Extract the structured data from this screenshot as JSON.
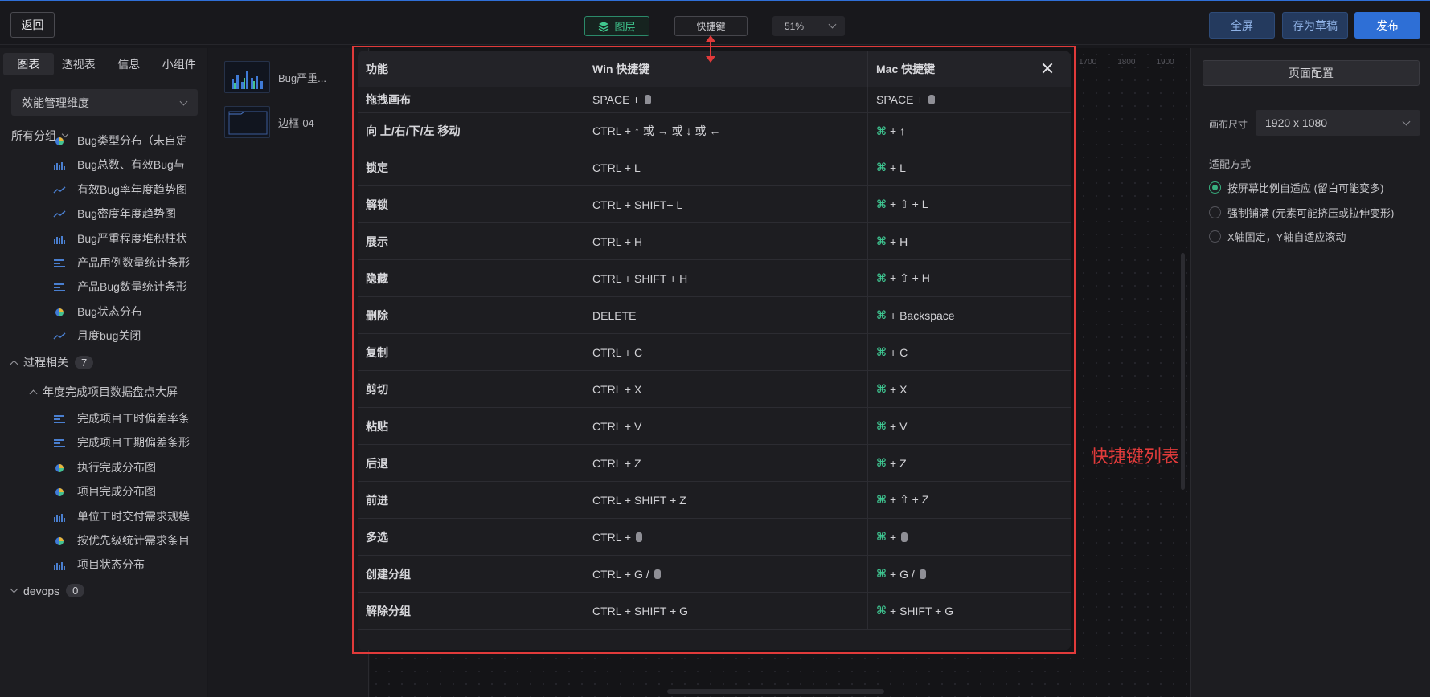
{
  "topbar": {
    "back": "返回",
    "layers": "图层",
    "shortcut": "快捷键",
    "zoom": "51%",
    "fullscreen": "全屏",
    "save_draft": "存为草稿",
    "publish": "发布"
  },
  "left_panel": {
    "tabs": [
      "图表",
      "透视表",
      "信息",
      "小组件"
    ],
    "dimension_select": "效能管理维度",
    "all_groups": "所有分组",
    "items_group1": [
      {
        "label": "Bug类型分布（未自定",
        "icon": "pie-chart-icon"
      },
      {
        "label": "Bug总数、有效Bug与",
        "icon": "bar-chart-icon"
      },
      {
        "label": "有效Bug率年度趋势图",
        "icon": "line-chart-icon"
      },
      {
        "label": "Bug密度年度趋势图",
        "icon": "line-chart-icon"
      },
      {
        "label": "Bug严重程度堆积柱状",
        "icon": "bar-chart-icon"
      },
      {
        "label": "产品用例数量统计条形",
        "icon": "hbar-chart-icon"
      },
      {
        "label": "产品Bug数量统计条形",
        "icon": "hbar-chart-icon"
      },
      {
        "label": "Bug状态分布",
        "icon": "pie-chart-icon"
      },
      {
        "label": "月度bug关闭",
        "icon": "line-chart-icon"
      }
    ],
    "group_process": {
      "label": "过程相关",
      "count": "7"
    },
    "subgroup": "年度完成项目数据盘点大屏",
    "items_group2": [
      {
        "label": "完成项目工时偏差率条",
        "icon": "hbar-chart-icon"
      },
      {
        "label": "完成项目工期偏差条形",
        "icon": "hbar-chart-icon"
      },
      {
        "label": "执行完成分布图",
        "icon": "pie-chart-icon"
      },
      {
        "label": "项目完成分布图",
        "icon": "pie-chart-icon"
      },
      {
        "label": "单位工时交付需求规模",
        "icon": "bar-chart-icon"
      },
      {
        "label": "按优先级统计需求条目",
        "icon": "pie-chart-icon"
      },
      {
        "label": "项目状态分布",
        "icon": "bar-chart-icon"
      }
    ],
    "group_devops": {
      "label": "devops",
      "count": "0"
    }
  },
  "layers": [
    {
      "label": "Bug严重..."
    },
    {
      "label": "边框-04"
    }
  ],
  "canvas": {
    "ruler": [
      "1700",
      "1800",
      "1900"
    ]
  },
  "right_panel": {
    "page_config": "页面配置",
    "size_label": "画布尺寸",
    "size_value": "1920 x 1080",
    "fit_label": "适配方式",
    "fit_options": [
      {
        "label": "按屏幕比例自适应 (留白可能变多)",
        "selected": true
      },
      {
        "label": "强制铺满 (元素可能挤压或拉伸变形)",
        "selected": false
      },
      {
        "label": "X轴固定，Y轴自适应滚动",
        "selected": false
      }
    ]
  },
  "modal": {
    "headers": [
      "功能",
      "Win 快捷键",
      "Mac 快捷键"
    ],
    "rows": [
      {
        "fn": "拖拽画布",
        "win": "SPACE + ",
        "win_mouse": true,
        "mac": "SPACE + ",
        "mac_cmd": false,
        "mac_mouse": true
      },
      {
        "fn": "向 上/右/下/左 移动",
        "win": "CTRL + ↑ 或 → 或 ↓ 或 ←",
        "win_mouse": false,
        "mac": "+ ↑",
        "mac_cmd": true,
        "mac_mouse": false
      },
      {
        "fn": "锁定",
        "win": "CTRL + L",
        "win_mouse": false,
        "mac": "+ L",
        "mac_cmd": true,
        "mac_mouse": false
      },
      {
        "fn": "解锁",
        "win": "CTRL + SHIFT+ L",
        "win_mouse": false,
        "mac": "+ ⇧ + L",
        "mac_cmd": true,
        "mac_mouse": false
      },
      {
        "fn": "展示",
        "win": "CTRL + H",
        "win_mouse": false,
        "mac": "+ H",
        "mac_cmd": true,
        "mac_mouse": false
      },
      {
        "fn": "隐藏",
        "win": "CTRL + SHIFT + H",
        "win_mouse": false,
        "mac": "+ ⇧ + H",
        "mac_cmd": true,
        "mac_mouse": false
      },
      {
        "fn": "删除",
        "win": "DELETE",
        "win_mouse": false,
        "mac": "+ Backspace",
        "mac_cmd": true,
        "mac_mouse": false
      },
      {
        "fn": "复制",
        "win": "CTRL + C",
        "win_mouse": false,
        "mac": "+ C",
        "mac_cmd": true,
        "mac_mouse": false
      },
      {
        "fn": "剪切",
        "win": "CTRL + X",
        "win_mouse": false,
        "mac": "+ X",
        "mac_cmd": true,
        "mac_mouse": false
      },
      {
        "fn": "粘贴",
        "win": "CTRL + V",
        "win_mouse": false,
        "mac": "+ V",
        "mac_cmd": true,
        "mac_mouse": false
      },
      {
        "fn": "后退",
        "win": "CTRL + Z",
        "win_mouse": false,
        "mac": "+ Z",
        "mac_cmd": true,
        "mac_mouse": false
      },
      {
        "fn": "前进",
        "win": "CTRL + SHIFT + Z",
        "win_mouse": false,
        "mac": "+ ⇧ + Z",
        "mac_cmd": true,
        "mac_mouse": false
      },
      {
        "fn": "多选",
        "win": "CTRL + ",
        "win_mouse": true,
        "mac": "+ ",
        "mac_cmd": true,
        "mac_mouse": true
      },
      {
        "fn": "创建分组",
        "win": "CTRL + G / ",
        "win_mouse": true,
        "mac": "+ G / ",
        "mac_cmd": true,
        "mac_mouse": true
      },
      {
        "fn": "解除分组",
        "win": "CTRL + SHIFT + G",
        "win_mouse": false,
        "mac": "+ SHIFT + G",
        "mac_cmd": true,
        "mac_mouse": false
      }
    ]
  },
  "annotation": "快捷键列表",
  "colors": {
    "accent": "#2e6fd6",
    "green": "#3ec490",
    "annotation_red": "#e03a3a"
  }
}
